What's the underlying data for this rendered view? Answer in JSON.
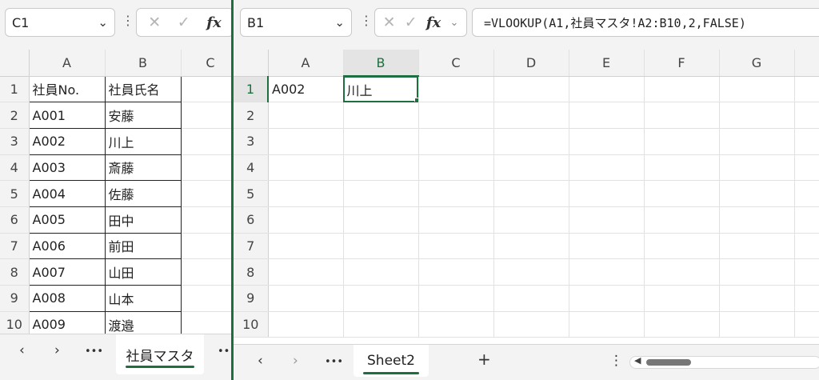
{
  "left": {
    "namebox": "C1",
    "columns": [
      "A",
      "B",
      "C"
    ],
    "rows": [
      {
        "n": "1",
        "a": "社員No.",
        "b": "社員氏名"
      },
      {
        "n": "2",
        "a": "A001",
        "b": "安藤"
      },
      {
        "n": "3",
        "a": "A002",
        "b": "川上"
      },
      {
        "n": "4",
        "a": "A003",
        "b": "斎藤"
      },
      {
        "n": "5",
        "a": "A004",
        "b": "佐藤"
      },
      {
        "n": "6",
        "a": "A005",
        "b": "田中"
      },
      {
        "n": "7",
        "a": "A006",
        "b": "前田"
      },
      {
        "n": "8",
        "a": "A007",
        "b": "山田"
      },
      {
        "n": "9",
        "a": "A008",
        "b": "山本"
      },
      {
        "n": "10",
        "a": "A009",
        "b": "渡邉"
      }
    ],
    "tabs": {
      "prev": "‹",
      "next": "›",
      "more": "•••",
      "sheet": "社員マスタ",
      "more2": "•••"
    }
  },
  "right": {
    "namebox": "B1",
    "formula": "=VLOOKUP(A1,社員マスタ!A2:B10,2,FALSE)",
    "columns": [
      "A",
      "B",
      "C",
      "D",
      "E",
      "F",
      "G"
    ],
    "rows": [
      "1",
      "2",
      "3",
      "4",
      "5",
      "6",
      "7",
      "8",
      "9",
      "10"
    ],
    "a1": "A002",
    "b1": "川上",
    "tabs": {
      "prev": "‹",
      "next": "›",
      "more": "•••",
      "sheet": "Sheet2",
      "add": "+",
      "options": "⋮"
    }
  },
  "icons": {
    "cancel": "✕",
    "enter": "✓",
    "fx": "fx",
    "chevron": "⌵"
  },
  "colors": {
    "accent": "#1e6f3f"
  }
}
